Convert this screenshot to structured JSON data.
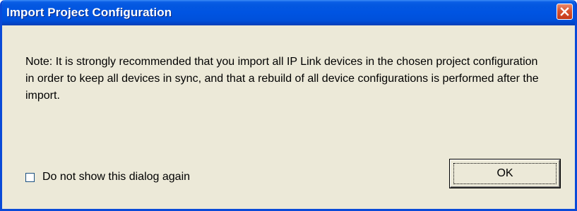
{
  "window": {
    "title": "Import Project Configuration"
  },
  "dialog": {
    "note": "Note: It is strongly recommended that you import all IP Link devices in the chosen project configuration in order to keep all devices in sync, and that a rebuild of all device configurations is performed after the import.",
    "checkbox_label": "Do not show this dialog again",
    "checkbox_checked": false,
    "ok_label": "OK"
  },
  "icons": {
    "close": "close-icon"
  },
  "colors": {
    "titlebar": "#0054e2",
    "window_face": "#ece9d8",
    "close_button": "#d8522e"
  }
}
